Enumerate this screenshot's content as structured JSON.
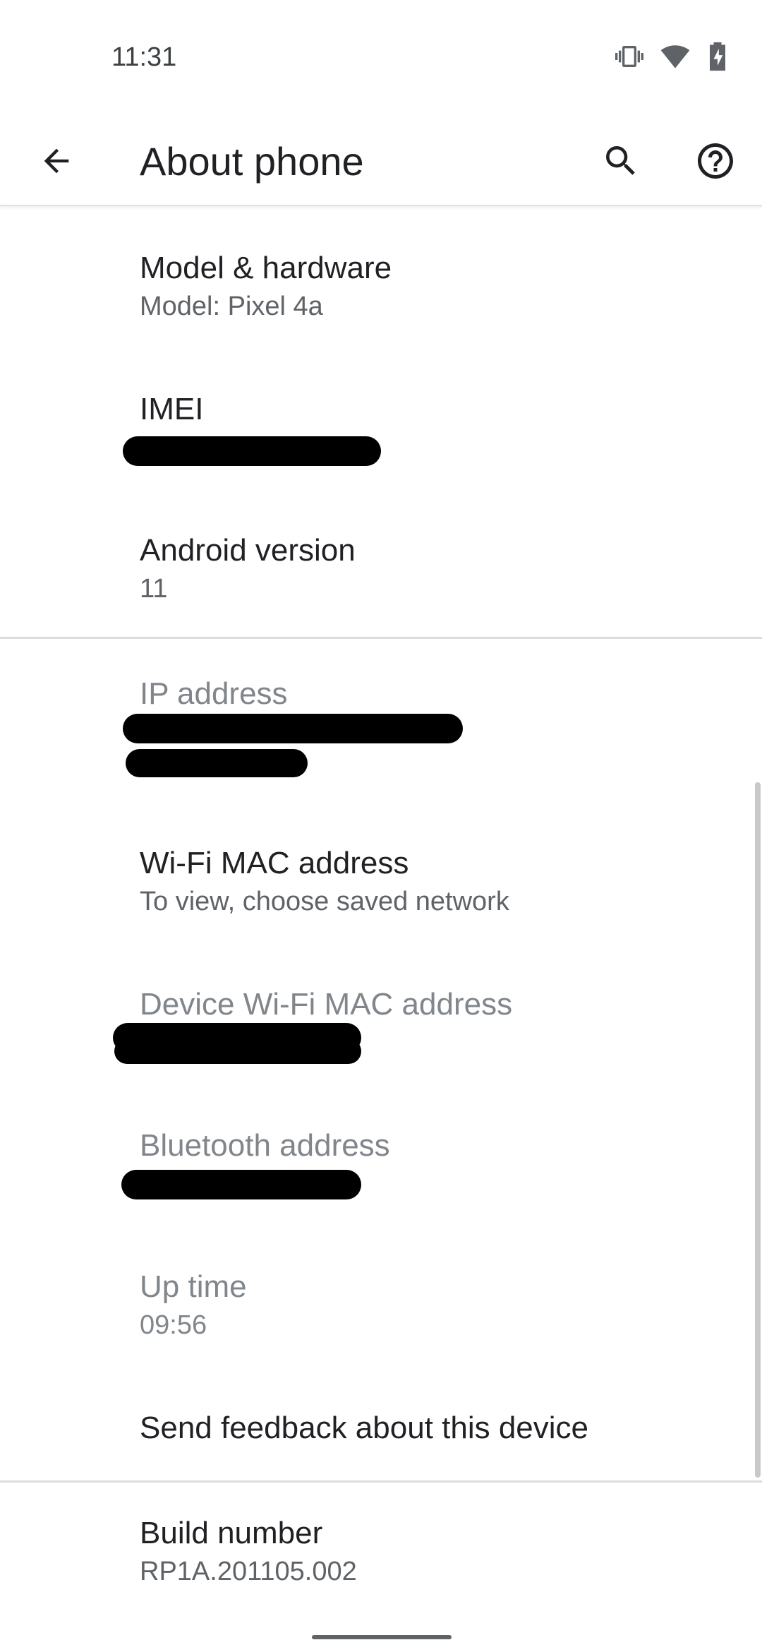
{
  "status_bar": {
    "time": "11:31",
    "icons": [
      "vibrate-icon",
      "wifi-icon",
      "battery-charging-icon"
    ]
  },
  "toolbar": {
    "title": "About phone",
    "back_icon": "arrow-back-icon",
    "search_icon": "search-icon",
    "help_icon": "help-icon"
  },
  "items": {
    "model": {
      "title": "Model & hardware",
      "summary": "Model: Pixel 4a"
    },
    "imei": {
      "title": "IMEI"
    },
    "android": {
      "title": "Android version",
      "summary": "11"
    },
    "ip": {
      "title": "IP address"
    },
    "wifi_mac": {
      "title": "Wi-Fi MAC address",
      "summary": "To view, choose saved network"
    },
    "device_mac": {
      "title": "Device Wi-Fi MAC address"
    },
    "bluetooth": {
      "title": "Bluetooth address"
    },
    "uptime": {
      "title": "Up time",
      "summary": "09:56"
    },
    "feedback": {
      "title": "Send feedback about this device"
    },
    "build": {
      "title": "Build number",
      "summary": "RP1A.201105.002"
    }
  },
  "colors": {
    "title": "#202124",
    "summary": "#5f6368",
    "disabled": "#80868b",
    "divider": "#dadce0"
  }
}
